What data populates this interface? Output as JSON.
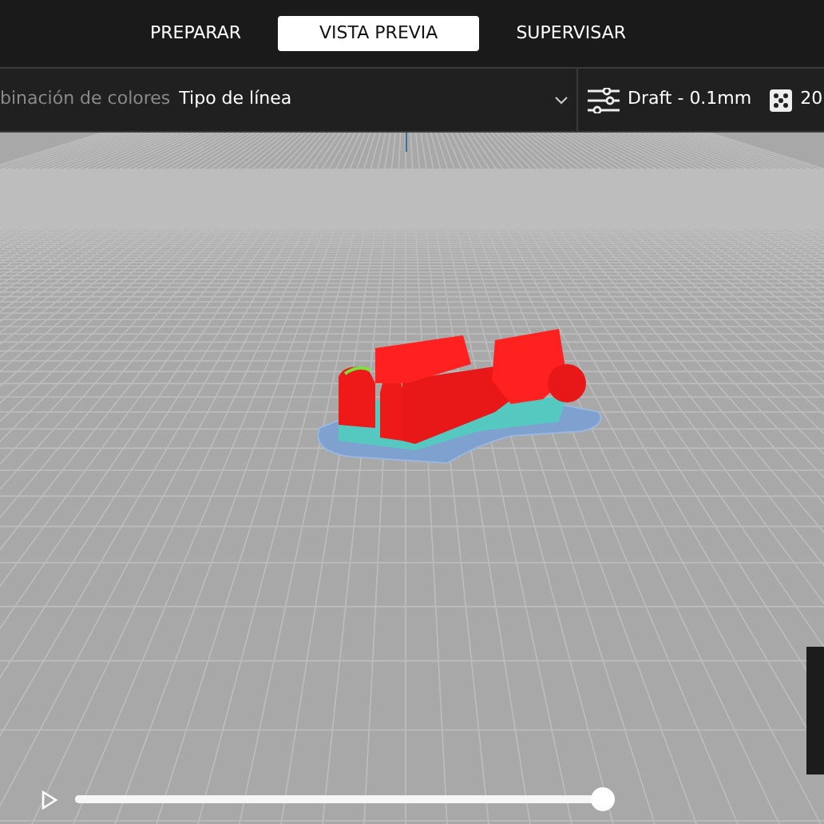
{
  "tabs": [
    {
      "label": "PREPARAR",
      "selected": false
    },
    {
      "label": "VISTA PREVIA",
      "selected": true
    },
    {
      "label": "SUPERVISAR",
      "selected": false
    }
  ],
  "toolbar": {
    "color_scheme_label": "binación de colores",
    "color_scheme_value": "Tipo de línea",
    "profile": "Draft - 0.1mm",
    "infill": "20"
  },
  "playback": {
    "level": 1.0
  }
}
